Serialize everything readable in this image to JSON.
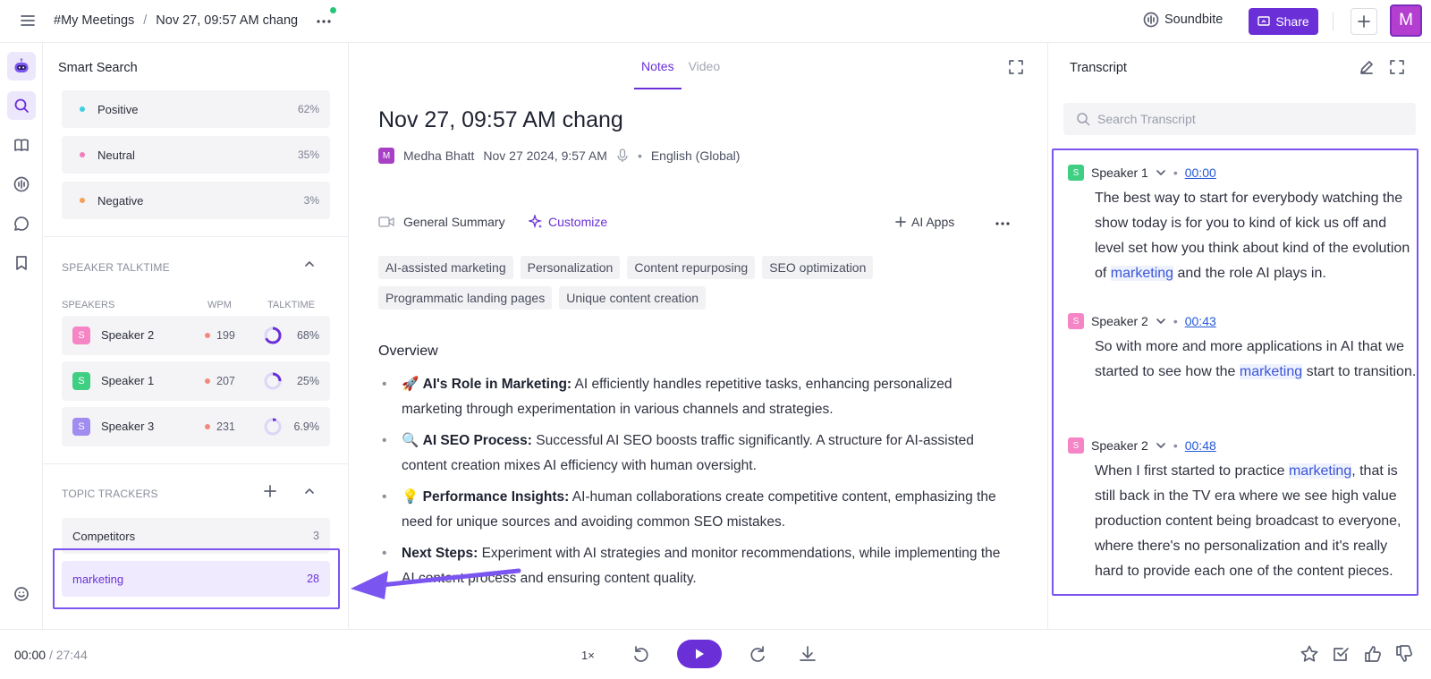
{
  "topbar": {
    "breadcrumb_folder": "#My Meetings",
    "breadcrumb_sep": "/",
    "breadcrumb_meeting": "Nov 27, 09:57 AM chang",
    "soundbite_label": "Soundbite",
    "share_label": "Share",
    "avatar_letter": "M"
  },
  "left_panel": {
    "title": "Smart Search",
    "sentiments": [
      {
        "label": "Positive",
        "pct": "62%",
        "color": "#3ccfe0"
      },
      {
        "label": "Neutral",
        "pct": "35%",
        "color": "#f07fb8"
      },
      {
        "label": "Negative",
        "pct": "3%",
        "color": "#f5a05a"
      }
    ],
    "talktime_header": "SPEAKER TALKTIME",
    "col_speakers": "SPEAKERS",
    "col_wpm": "WPM",
    "col_talktime": "TALKTIME",
    "speakers": [
      {
        "initial": "S",
        "name": "Speaker 2",
        "wpm": "199",
        "talktime": "68%",
        "color": "#f585c4",
        "share": 0.68
      },
      {
        "initial": "S",
        "name": "Speaker 1",
        "wpm": "207",
        "talktime": "25%",
        "color": "#3fcf83",
        "share": 0.25
      },
      {
        "initial": "S",
        "name": "Speaker 3",
        "wpm": "231",
        "talktime": "6.9%",
        "color": "#a18cf0",
        "share": 0.069
      }
    ],
    "topic_header": "TOPIC TRACKERS",
    "trackers": [
      {
        "name": "Competitors",
        "count": "3"
      },
      {
        "name": "marketing",
        "count": "28"
      }
    ]
  },
  "middle": {
    "tab_notes": "Notes",
    "tab_video": "Video",
    "title": "Nov 27, 09:57 AM chang",
    "owner_initial": "M",
    "owner": "Medha Bhatt",
    "datetime": "Nov 27 2024, 9:57 AM",
    "dot": "•",
    "language": "English (Global)",
    "summary_label": "General Summary",
    "customize_label": "Customize",
    "ai_apps_label": "AI Apps",
    "chips": [
      "AI-assisted marketing",
      "Personalization",
      "Content repurposing",
      "SEO optimization",
      "Programmatic landing pages",
      "Unique content creation"
    ],
    "overview_title": "Overview",
    "bullets": [
      {
        "emoji": "🚀",
        "head": "AI's Role in Marketing:",
        "body": " AI efficiently handles repetitive tasks, enhancing personalized marketing through experimentation in various channels and strategies."
      },
      {
        "emoji": "🔍",
        "head": "AI SEO Process:",
        "body": " Successful AI SEO boosts traffic significantly. A structure for AI-assisted content creation mixes AI efficiency with human oversight."
      },
      {
        "emoji": "💡",
        "head": "Performance Insights:",
        "body": " AI-human collaborations create competitive content, emphasizing the need for unique sources and avoiding common SEO mistakes."
      },
      {
        "emoji": "",
        "head": "Next Steps:",
        "body": " Experiment with AI strategies and monitor recommendations, while implementing the AI content process and ensuring content quality."
      }
    ]
  },
  "transcript": {
    "title": "Transcript",
    "search_placeholder": "Search Transcript",
    "utterances": [
      {
        "initial": "S",
        "speaker": "Speaker 1",
        "dot": "•",
        "time": "00:00",
        "color": "#3fcf83",
        "pre": "The best way to start for everybody watching the show today is for you to kind of kick us off and level set how you think about kind of the evolution of ",
        "hl": "marketing",
        "post": " and the role AI plays in."
      },
      {
        "initial": "S",
        "speaker": "Speaker 2",
        "dot": "•",
        "time": "00:43",
        "color": "#f585c4",
        "pre": "So with more and more applications in AI that we started to see how the ",
        "hl": "marketing",
        "post": " start to transition."
      },
      {
        "initial": "S",
        "speaker": "Speaker 2",
        "dot": "•",
        "time": "00:48",
        "color": "#f585c4",
        "pre": "When I first started to practice ",
        "hl": "marketing",
        "post": ", that is still back in the TV era where we see high value production content being broadcast to everyone, where there's no personalization and it's really hard to provide each one of the content pieces."
      }
    ]
  },
  "player": {
    "current": "00:00",
    "sep": "/",
    "total": "27:44",
    "speed": "1×"
  },
  "colors": {
    "accent": "#6b2fd8",
    "highlight_box": "#7b55f0"
  }
}
